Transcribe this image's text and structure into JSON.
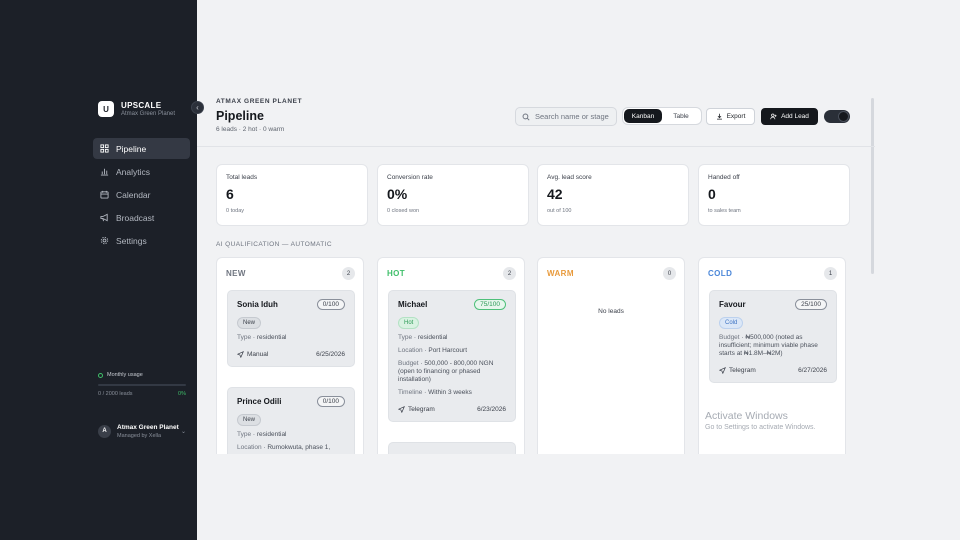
{
  "brand": {
    "logo_letter": "U",
    "name": "UPSCALE",
    "subtitle": "Atmax Green Planet"
  },
  "collapse_icon": "chevron-left-icon",
  "sidebar": {
    "items": [
      {
        "label": "Pipeline",
        "icon": "grid-icon",
        "active": true
      },
      {
        "label": "Analytics",
        "icon": "bar-chart-icon",
        "active": false
      },
      {
        "label": "Calendar",
        "icon": "calendar-icon",
        "active": false
      },
      {
        "label": "Broadcast",
        "icon": "megaphone-icon",
        "active": false
      },
      {
        "label": "Settings",
        "icon": "gear-icon",
        "active": false
      }
    ],
    "usage": {
      "title": "Monthly usage",
      "count_text": "0 / 2000 leads",
      "percent_text": "0%",
      "fraction": 0
    },
    "account": {
      "avatar_letter": "A",
      "name": "Atmax Green Planet",
      "subtitle": "Managed by Xella"
    }
  },
  "header": {
    "eyebrow": "ATMAX GREEN PLANET",
    "title": "Pipeline",
    "meta": "6 leads · 2 hot · 0 warm",
    "search_placeholder": "Search name or stage",
    "view_tabs": [
      {
        "label": "Kanban",
        "active": true
      },
      {
        "label": "Table",
        "active": false
      }
    ],
    "export_label": "Export",
    "add_label": "Add Lead"
  },
  "stats": [
    {
      "label": "Total leads",
      "value": "6",
      "sub": "0 today"
    },
    {
      "label": "Conversion rate",
      "value": "0%",
      "sub": "0 closed won"
    },
    {
      "label": "Avg. lead score",
      "value": "42",
      "sub": "out of 100"
    },
    {
      "label": "Handed off",
      "value": "0",
      "sub": "to sales team"
    }
  ],
  "section_label": "AI QUALIFICATION — AUTOMATIC",
  "columns": [
    {
      "title": "NEW",
      "count": "2",
      "color": "#6f7580",
      "cards": [
        {
          "name": "Sonia Iduh",
          "score": "0/100",
          "badge": "New",
          "fields": [
            {
              "k": "Type",
              "v": "residential"
            }
          ],
          "source": "Manual",
          "date": "6/25/2026"
        },
        {
          "name": "Prince Odili",
          "score": "0/100",
          "badge": "New",
          "fields": [
            {
              "k": "Type",
              "v": "residential"
            },
            {
              "k": "Location",
              "v": "Rumokwuta, phase 1,"
            }
          ],
          "source": "",
          "date": ""
        }
      ]
    },
    {
      "title": "HOT",
      "count": "2",
      "color": "#3fbf6a",
      "cards": [
        {
          "name": "Michael",
          "score": "75/100",
          "badge": "Hot",
          "fields": [
            {
              "k": "Type",
              "v": "residential"
            },
            {
              "k": "Location",
              "v": "Port Harcourt"
            },
            {
              "k": "Budget",
              "v": "500,000 - 800,000 NGN (open to financing or phased installation)"
            },
            {
              "k": "Timeline",
              "v": "Within 3 weeks"
            }
          ],
          "source": "Telegram",
          "date": "6/23/2026"
        }
      ]
    },
    {
      "title": "WARM",
      "count": "0",
      "color": "#e89a3c",
      "empty_text": "No leads",
      "cards": []
    },
    {
      "title": "COLD",
      "count": "1",
      "color": "#4a86d8",
      "cards": [
        {
          "name": "Favour",
          "score": "25/100",
          "badge": "Cold",
          "fields": [
            {
              "k": "Budget",
              "v": "₦500,000 (noted as insufficient; minimum viable phase starts at ₦1.8M–₦2M)"
            }
          ],
          "source": "Telegram",
          "date": "6/27/2026"
        }
      ]
    }
  ],
  "watermark": {
    "title": "Activate Windows",
    "subtitle": "Go to Settings to activate Windows."
  }
}
